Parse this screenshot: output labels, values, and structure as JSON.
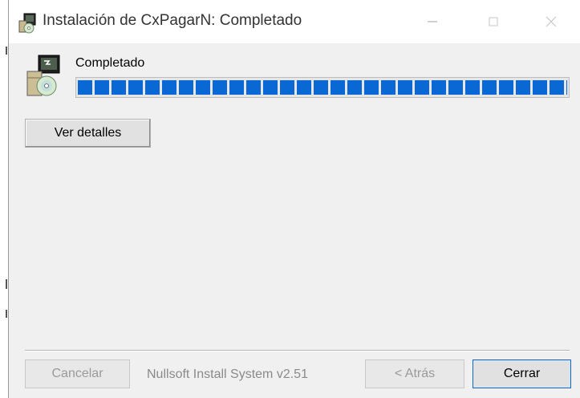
{
  "window": {
    "title": "Instalación de CxPagarN: Completado",
    "controls": {
      "minimize_icon": "minimize-icon",
      "maximize_icon": "maximize-icon",
      "close_icon": "close-icon"
    }
  },
  "status": {
    "text": "Completado",
    "progress_fraction": 1.0
  },
  "buttons": {
    "details": "Ver detalles",
    "cancel": "Cancelar",
    "back": "< Atrás",
    "close": "Cerrar"
  },
  "branding": "Nullsoft Install System v2.51",
  "colors": {
    "progress": "#0a68d4",
    "accent_border": "#0a68d4",
    "background": "#f0f0f0"
  }
}
